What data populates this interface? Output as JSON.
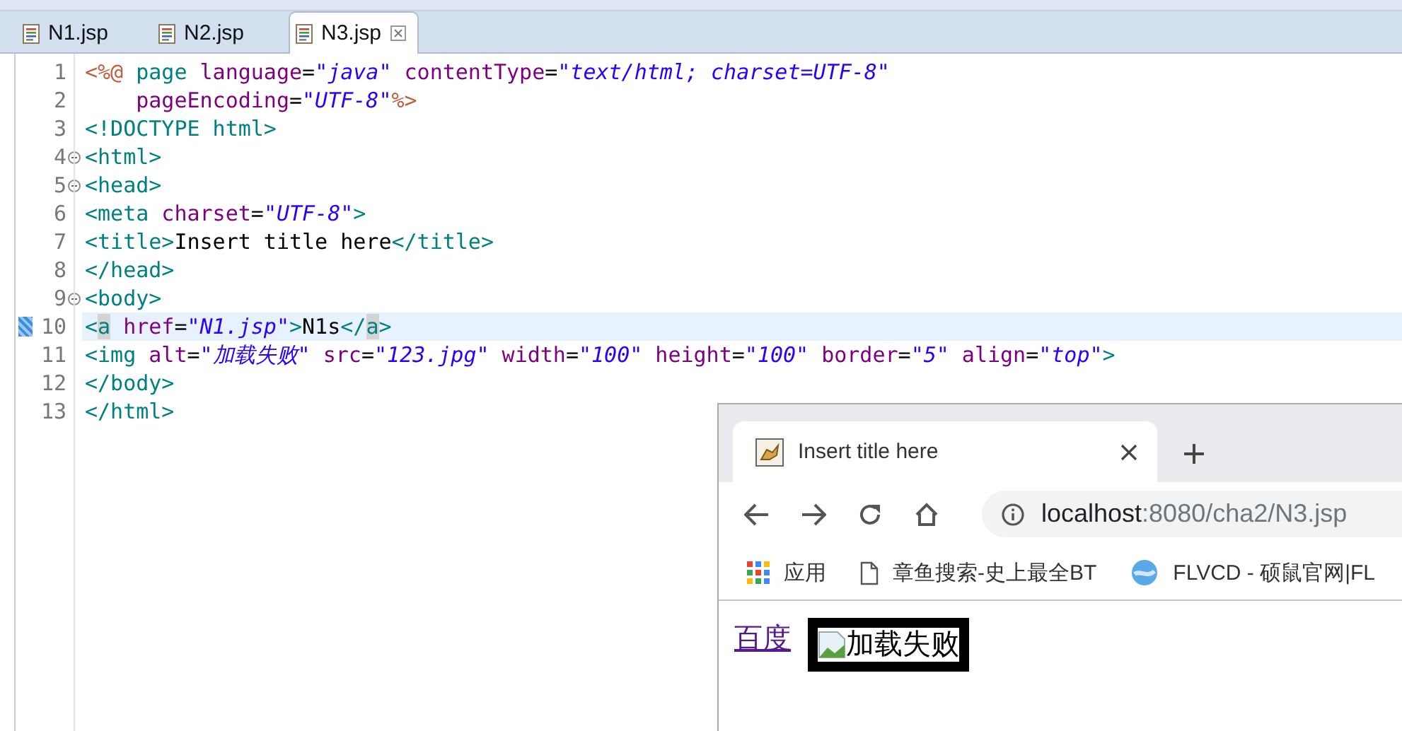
{
  "editor_tabs": [
    {
      "label": "N1.jsp",
      "selected": false
    },
    {
      "label": "N2.jsp",
      "selected": false
    },
    {
      "label": "N3.jsp",
      "selected": true
    }
  ],
  "code_lines": [
    {
      "number": "1",
      "fold": false,
      "current": false,
      "tokens": [
        {
          "kind": "jsp",
          "text": "<%@"
        },
        {
          "kind": "tag",
          "text": " page"
        },
        {
          "kind": "attr",
          "text": " language"
        },
        {
          "kind": "text",
          "text": "="
        },
        {
          "kind": "value",
          "text": "\"java\""
        },
        {
          "kind": "attr",
          "text": " contentType"
        },
        {
          "kind": "text",
          "text": "="
        },
        {
          "kind": "value",
          "text": "\"text/html; charset=UTF-8\""
        }
      ]
    },
    {
      "number": "2",
      "fold": false,
      "current": false,
      "tokens": [
        {
          "kind": "attr",
          "text": "    pageEncoding"
        },
        {
          "kind": "text",
          "text": "="
        },
        {
          "kind": "value",
          "text": "\"UTF-8\""
        },
        {
          "kind": "jsp",
          "text": "%>"
        }
      ]
    },
    {
      "number": "3",
      "fold": false,
      "current": false,
      "tokens": [
        {
          "kind": "tag",
          "text": "<!DOCTYPE html>"
        }
      ]
    },
    {
      "number": "4",
      "fold": true,
      "current": false,
      "tokens": [
        {
          "kind": "tag",
          "text": "<html>"
        }
      ]
    },
    {
      "number": "5",
      "fold": true,
      "current": false,
      "tokens": [
        {
          "kind": "tag",
          "text": "<head>"
        }
      ]
    },
    {
      "number": "6",
      "fold": false,
      "current": false,
      "tokens": [
        {
          "kind": "tag",
          "text": "<meta"
        },
        {
          "kind": "attr",
          "text": " charset"
        },
        {
          "kind": "text",
          "text": "="
        },
        {
          "kind": "value",
          "text": "\"UTF-8\""
        },
        {
          "kind": "tag",
          "text": ">"
        }
      ]
    },
    {
      "number": "7",
      "fold": false,
      "current": false,
      "tokens": [
        {
          "kind": "tag",
          "text": "<title>"
        },
        {
          "kind": "text",
          "text": "Insert title here"
        },
        {
          "kind": "tag",
          "text": "</title>"
        }
      ]
    },
    {
      "number": "8",
      "fold": false,
      "current": false,
      "tokens": [
        {
          "kind": "tag",
          "text": "</head>"
        }
      ]
    },
    {
      "number": "9",
      "fold": true,
      "current": false,
      "tokens": [
        {
          "kind": "tag",
          "text": "<body>"
        }
      ]
    },
    {
      "number": "10",
      "fold": false,
      "current": true,
      "tokens": [
        {
          "kind": "tag",
          "text": "<"
        },
        {
          "kind": "match",
          "text": "a"
        },
        {
          "kind": "attr",
          "text": " href"
        },
        {
          "kind": "text",
          "text": "="
        },
        {
          "kind": "value",
          "text": "\"N1.jsp\""
        },
        {
          "kind": "tag",
          "text": ">"
        },
        {
          "kind": "text",
          "text": "N1s"
        },
        {
          "kind": "tag",
          "text": "</"
        },
        {
          "kind": "match",
          "text": "a"
        },
        {
          "kind": "tag",
          "text": ">"
        }
      ]
    },
    {
      "number": "11",
      "fold": false,
      "current": false,
      "tokens": [
        {
          "kind": "tag",
          "text": "<img"
        },
        {
          "kind": "attr",
          "text": " alt"
        },
        {
          "kind": "text",
          "text": "="
        },
        {
          "kind": "value",
          "text": "\"加载失败\""
        },
        {
          "kind": "attr",
          "text": " src"
        },
        {
          "kind": "text",
          "text": "="
        },
        {
          "kind": "value",
          "text": "\"123.jpg\""
        },
        {
          "kind": "attr",
          "text": " width"
        },
        {
          "kind": "text",
          "text": "="
        },
        {
          "kind": "value",
          "text": "\"100\""
        },
        {
          "kind": "attr",
          "text": " height"
        },
        {
          "kind": "text",
          "text": "="
        },
        {
          "kind": "value",
          "text": "\"100\""
        },
        {
          "kind": "attr",
          "text": " border"
        },
        {
          "kind": "text",
          "text": "="
        },
        {
          "kind": "value",
          "text": "\"5\""
        },
        {
          "kind": "attr",
          "text": " align"
        },
        {
          "kind": "text",
          "text": "="
        },
        {
          "kind": "value",
          "text": "\"top\""
        },
        {
          "kind": "tag",
          "text": ">"
        }
      ]
    },
    {
      "number": "12",
      "fold": false,
      "current": false,
      "tokens": [
        {
          "kind": "tag",
          "text": "</body>"
        }
      ]
    },
    {
      "number": "13",
      "fold": false,
      "current": false,
      "tokens": [
        {
          "kind": "tag",
          "text": "</html>"
        }
      ]
    }
  ],
  "browser": {
    "tab": {
      "title": "Insert title here"
    },
    "address": {
      "host": "localhost",
      "rest": ":8080/cha2/N3.jsp"
    },
    "bookmarks": [
      {
        "kind": "apps",
        "label": "应用"
      },
      {
        "kind": "page",
        "label": "章鱼搜索-史上最全BT"
      },
      {
        "kind": "site",
        "label": "FLVCD - 硕鼠官网|FL"
      }
    ],
    "content": {
      "link": "百度",
      "image_alt": "加载失败"
    }
  }
}
